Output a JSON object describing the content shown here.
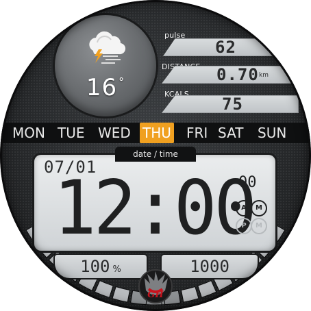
{
  "weather": {
    "icon": "cloud-lightning-wind-icon",
    "temperature": "16",
    "temperature_unit": "°"
  },
  "stats": {
    "pulse": {
      "label": "pulse",
      "value": "62"
    },
    "distance": {
      "label": "DISTANCE",
      "value": "0.70",
      "unit": "km"
    },
    "kcals": {
      "label": "KCALS",
      "value": "75"
    }
  },
  "weekdays": [
    "MON",
    "TUE",
    "WED",
    "THU",
    "FRI",
    "SAT",
    "SUN"
  ],
  "active_day": "THU",
  "lcd": {
    "tab_label": "date / time",
    "date": "07/01",
    "time": "12:00",
    "seconds": "00",
    "am_letters": [
      "A",
      "M"
    ],
    "pm_letters": [
      "P",
      "M"
    ]
  },
  "bottom": {
    "battery": "100",
    "battery_unit": "%",
    "steps": "1000"
  },
  "colors": {
    "accent": "#f0a020",
    "lcd_bg": "#e0e3e5",
    "panel": "#2a2c2e"
  },
  "logo": "dragon-gh-logo"
}
